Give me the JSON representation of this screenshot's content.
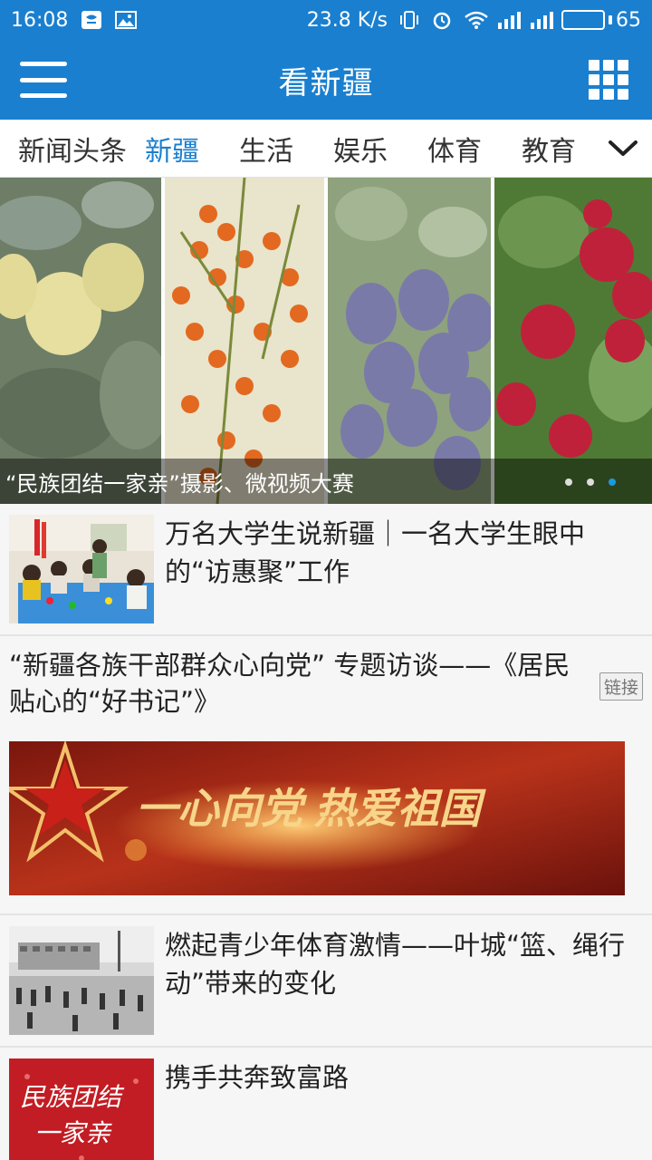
{
  "status_bar": {
    "time": "16:08",
    "speed": "23.8 K/s",
    "battery": "65",
    "battery_level": 0.65
  },
  "app_bar": {
    "title": "看新疆",
    "menu_icon": "hamburger-menu-icon",
    "apps_icon": "grid-apps-icon"
  },
  "tabs": [
    {
      "label": "新闻头条",
      "active": false
    },
    {
      "label": "新疆",
      "active": true
    },
    {
      "label": "生活",
      "active": false
    },
    {
      "label": "娱乐",
      "active": false
    },
    {
      "label": "体育",
      "active": false
    },
    {
      "label": "教育",
      "active": false
    }
  ],
  "banner": {
    "caption": "“民族团结一家亲”摄影、微视频大赛",
    "slide_count": 3,
    "active_slide": 3
  },
  "news": [
    {
      "headline": "万名大学生说新疆｜一名大学生眼中的“访惠聚”工作"
    },
    {
      "headline": "“新疆各族干部群众心向党” 专题访谈——《居民贴心的“好书记”》",
      "tag": "链接",
      "image_text": "一心向党 热爱祖国"
    },
    {
      "headline": "燃起青少年体育激情——叶城“篮、绳行动”带来的变化"
    },
    {
      "headline": "携手共奔致富路",
      "image_text": "民族团结 一家亲"
    }
  ],
  "colors": {
    "primary": "#1a7fcf",
    "active_tab": "#1a7fcf",
    "active_dot": "#1a9be0"
  }
}
